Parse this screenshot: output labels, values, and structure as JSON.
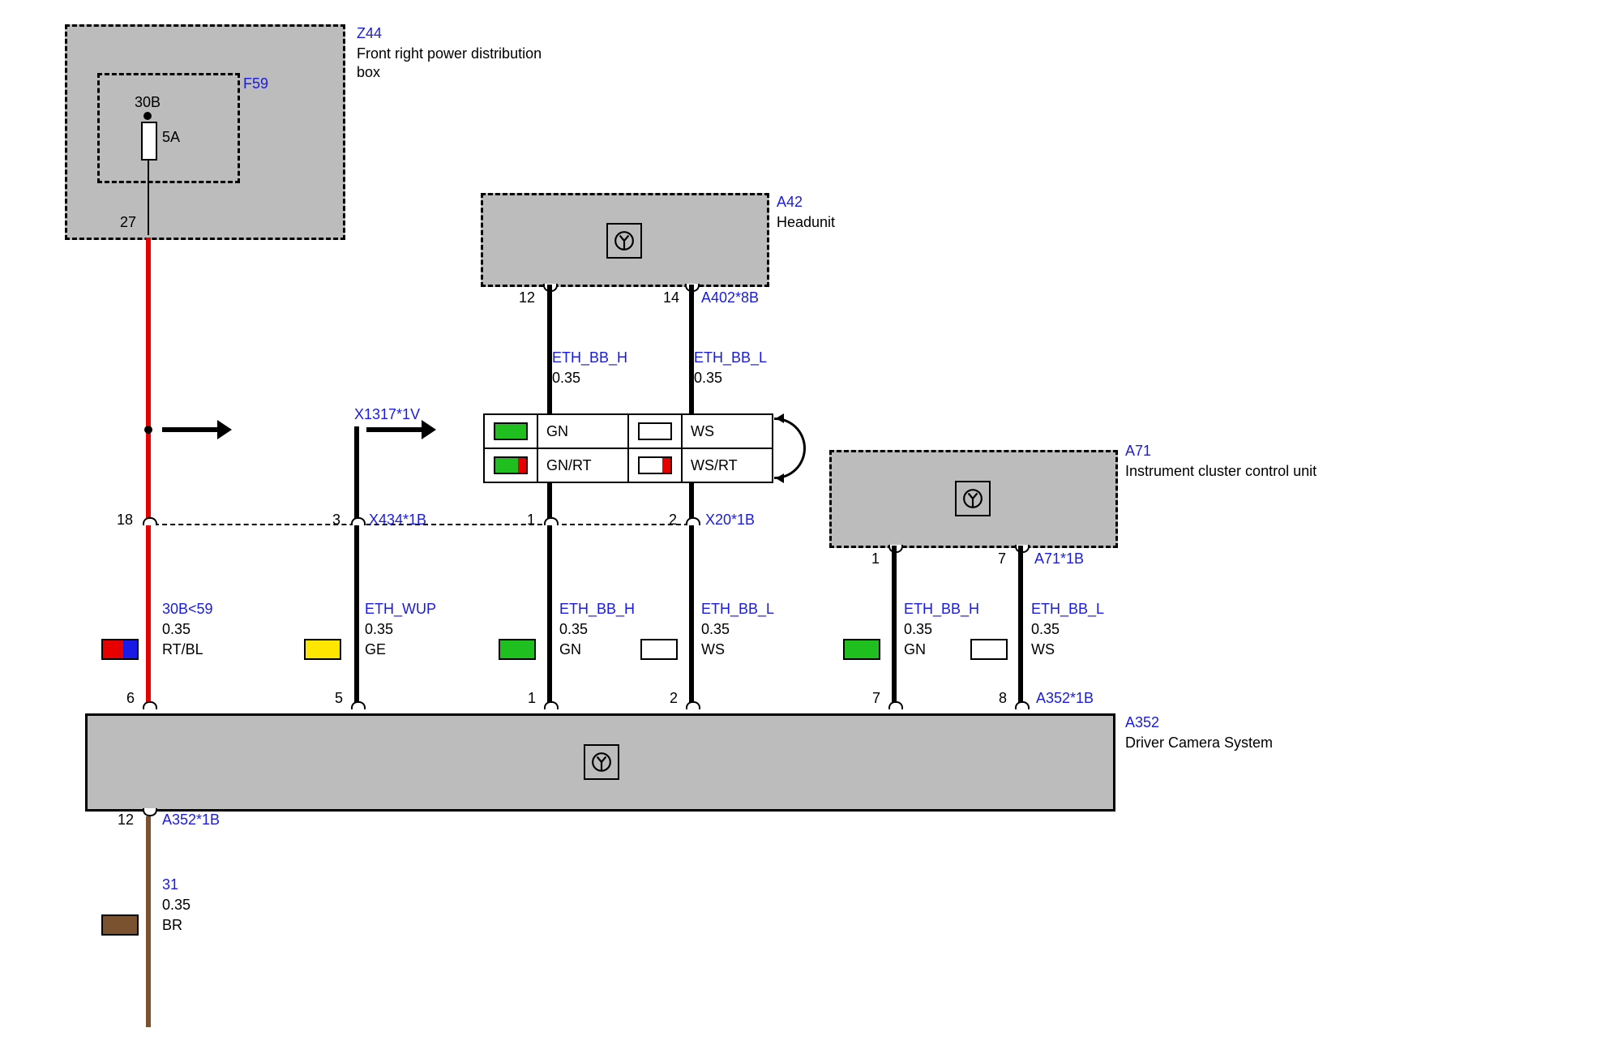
{
  "components": {
    "z44": {
      "id": "Z44",
      "name": "Front right power distribution\nbox",
      "fuse": {
        "id": "F59",
        "terminal": "30B",
        "rating": "5A",
        "pin_out": "27"
      }
    },
    "a42": {
      "id": "A42",
      "name": "Headunit",
      "pin_left": "12",
      "pin_right": "14",
      "conn": "A402*8B"
    },
    "a71": {
      "id": "A71",
      "name": "Instrument cluster control unit",
      "pin_left": "1",
      "pin_right": "7",
      "conn": "A71*1B"
    },
    "a352": {
      "id": "A352",
      "name": "Driver Camera System",
      "conn_top": "A352*1B",
      "conn_bot": "A352*1B",
      "pin_bot": "12"
    }
  },
  "splice": {
    "x1317": "X1317*1V"
  },
  "connector_rows": {
    "x434": {
      "id": "X434*1B",
      "pin_left": "18",
      "pin_right": "3"
    },
    "x20": {
      "id": "X20*1B",
      "pin_left": "1",
      "pin_right": "2"
    }
  },
  "wire_table": {
    "row1": {
      "left_color": "GN",
      "left_label": "GN",
      "right_color": "WS",
      "right_label": "WS"
    },
    "row2": {
      "left_color": "GN/RT",
      "left_label": "GN/RT",
      "right_color": "WS/RT",
      "right_label": "WS/RT"
    }
  },
  "signals": {
    "eth_bb_h": {
      "name": "ETH_BB_H",
      "gauge": "0.35"
    },
    "eth_bb_l": {
      "name": "ETH_BB_L",
      "gauge": "0.35"
    },
    "eth_wup": {
      "name": "ETH_WUP",
      "gauge": "0.35"
    },
    "pwr": {
      "name": "30B<59",
      "gauge": "0.35",
      "color": "RT/BL"
    },
    "gnd": {
      "name": "31",
      "gauge": "0.35",
      "color": "BR"
    }
  },
  "colors": {
    "GN": "GN",
    "WS": "WS",
    "GE": "GE",
    "RT_BL": "RT/BL",
    "BR": "BR"
  },
  "dcs_pins": {
    "p6": "6",
    "p5": "5",
    "p1": "1",
    "p2": "2",
    "p7": "7",
    "p8": "8"
  }
}
